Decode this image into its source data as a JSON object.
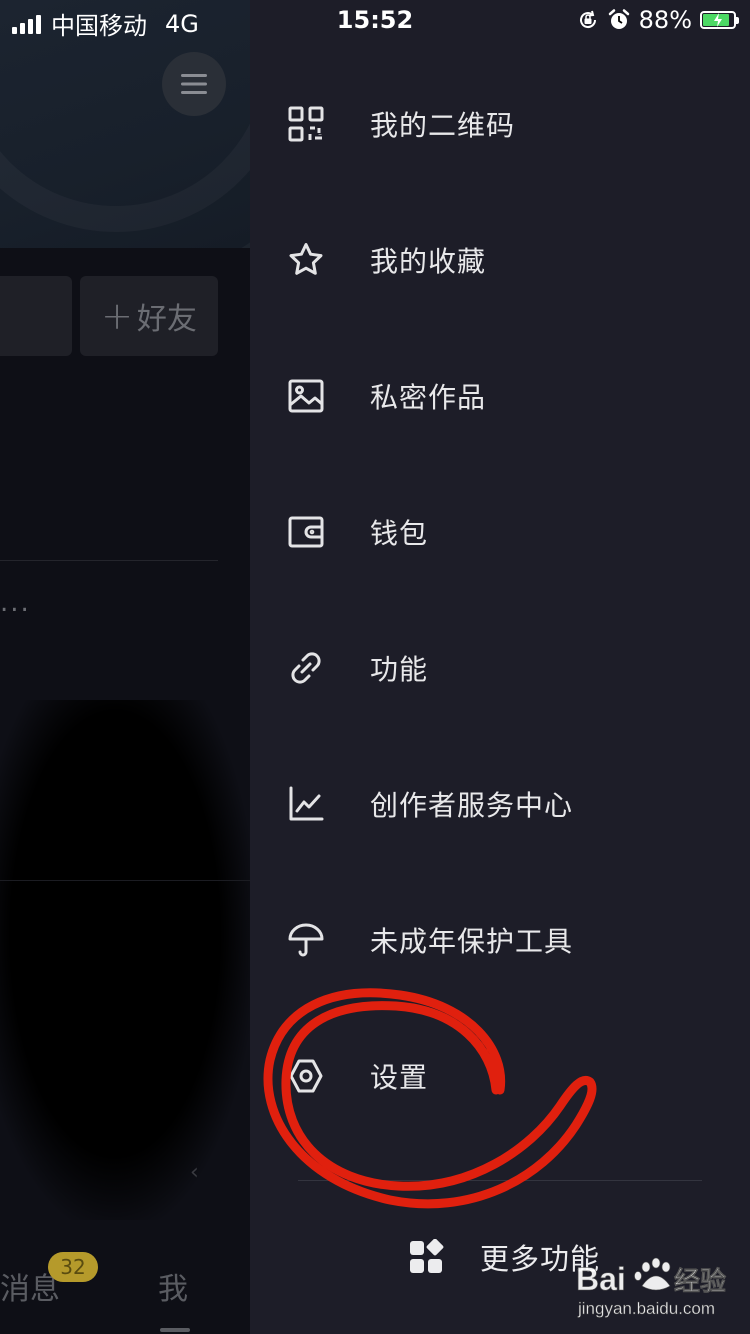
{
  "status_bar": {
    "carrier": "中国移动",
    "network": "4G",
    "time": "15:52",
    "battery_percent_label": "88%",
    "battery_level": 0.88
  },
  "background": {
    "add_friend_label": "好友",
    "add_friend_plus": "+",
    "dots": "...",
    "tab_messages": "消息",
    "message_badge": "32",
    "tab_me": "我"
  },
  "drawer": {
    "items": [
      {
        "label": "我的二维码",
        "icon": "qr-code-icon"
      },
      {
        "label": "我的收藏",
        "icon": "star-icon"
      },
      {
        "label": "私密作品",
        "icon": "image-icon"
      },
      {
        "label": "钱包",
        "icon": "wallet-icon"
      },
      {
        "label": "功能",
        "icon": "link-icon"
      },
      {
        "label": "创作者服务中心",
        "icon": "chart-icon"
      },
      {
        "label": "未成年保护工具",
        "icon": "umbrella-icon"
      },
      {
        "label": "设置",
        "icon": "hexagon-settings-icon"
      }
    ],
    "more_functions_label": "更多功能"
  },
  "watermark": {
    "brand_left": "Bai",
    "brand_right": "经验",
    "url": "jingyan.baidu.com"
  },
  "colors": {
    "drawer_bg": "#1d1d28",
    "annotation_red": "#e0200e",
    "text_primary": "#e8e8ea"
  }
}
